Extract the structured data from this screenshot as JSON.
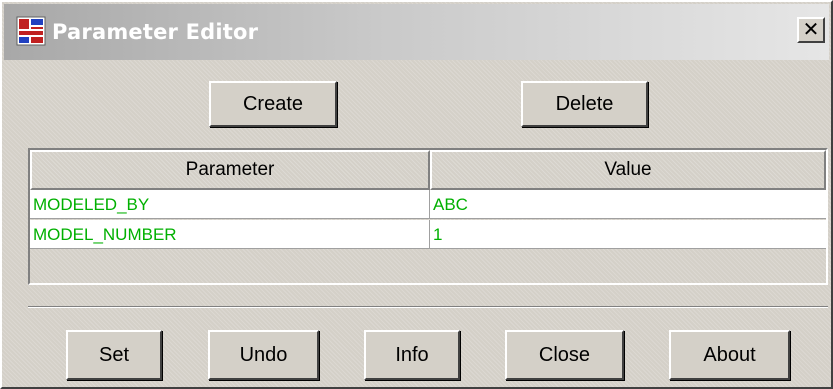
{
  "window": {
    "title": "Parameter Editor",
    "icon": "app-icon",
    "close_glyph": "✕"
  },
  "top_actions": {
    "create_label": "Create",
    "delete_label": "Delete"
  },
  "table": {
    "columns": [
      "Parameter",
      "Value"
    ],
    "rows": [
      {
        "parameter": "MODELED_BY",
        "value": "ABC"
      },
      {
        "parameter": "MODEL_NUMBER",
        "value": "1"
      }
    ]
  },
  "bottom_actions": {
    "set_label": "Set",
    "undo_label": "Undo",
    "info_label": "Info",
    "close_label": "Close",
    "about_label": "About"
  },
  "colors": {
    "cell_text": "#00b000",
    "face": "#d4d0c8",
    "title_gradient_start": "#a8a8a8",
    "title_gradient_end": "#e6e6e6"
  }
}
